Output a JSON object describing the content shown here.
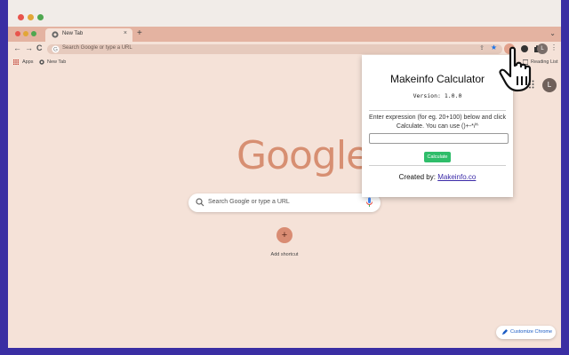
{
  "window": {
    "tab_title": "New Tab",
    "tab_close": "×",
    "new_tab": "+",
    "tab_menu": "⌄"
  },
  "toolbar": {
    "back": "←",
    "forward": "→",
    "reload": "C",
    "omnibox_placeholder": "Search Google or type a URL",
    "profile_initial": "L",
    "more": "⋮"
  },
  "bookmarks": {
    "items": [
      "Apps",
      "New Tab"
    ],
    "reading_list": "Reading List"
  },
  "ntp": {
    "logo_text": "Google",
    "search_placeholder": "Search Google or type a URL",
    "shortcut_plus": "+",
    "shortcut_label": "Add shortcut",
    "avatar_initial": "L",
    "customize_label": "Customize Chrome"
  },
  "popup": {
    "title": "Makeinfo Calculator",
    "version": "Version: 1.0.0",
    "description": "Enter expression (for eg. 20+100) below and click Calculate. You can use ()+-*/^",
    "input_value": "",
    "button_label": "Calculate",
    "credit_prefix": "Created by:",
    "credit_link": "Makeinfo.co"
  },
  "colors": {
    "frame": "#3a2ea3",
    "tabstrip": "#e4b3a1",
    "page": "#f5e2d8",
    "google_logo": "#d78f72",
    "accent_green": "#2fbd6a"
  },
  "icons": [
    "google-icon",
    "share-icon",
    "star-icon",
    "extension-icon",
    "puzzle-icon",
    "apps-icon",
    "search-icon",
    "mic-icon",
    "pencil-icon",
    "hand-cursor-icon"
  ]
}
